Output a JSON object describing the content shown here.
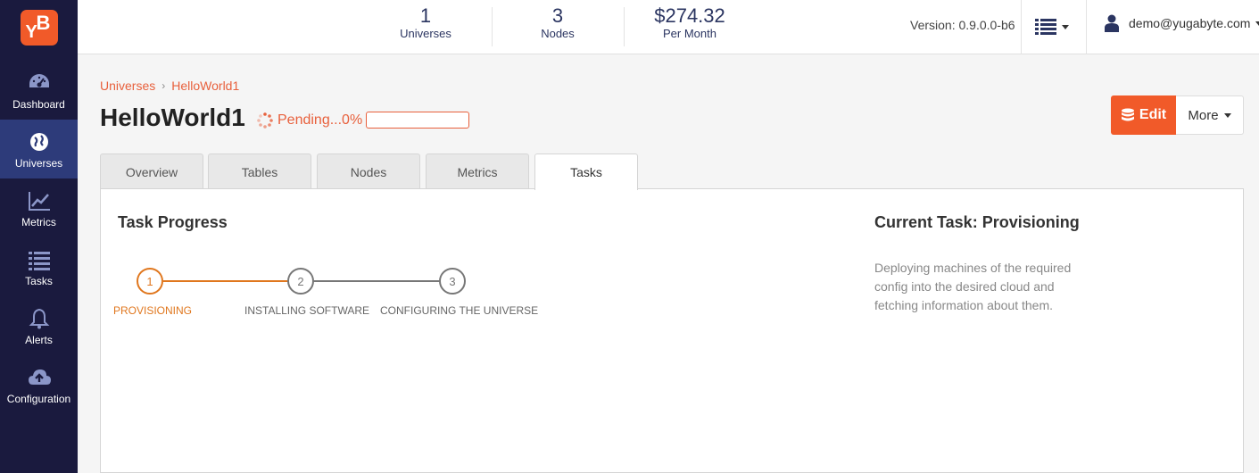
{
  "logo": {
    "l1": "Y",
    "l2": "B"
  },
  "sidebar": {
    "items": [
      {
        "label": "Dashboard",
        "icon": "dashboard-icon"
      },
      {
        "label": "Universes",
        "icon": "globe-icon",
        "active": true
      },
      {
        "label": "Metrics",
        "icon": "line-chart-icon"
      },
      {
        "label": "Tasks",
        "icon": "list-icon"
      },
      {
        "label": "Alerts",
        "icon": "bell-icon"
      },
      {
        "label": "Configuration",
        "icon": "cloud-upload-icon"
      }
    ]
  },
  "header": {
    "stats": [
      {
        "value": "1",
        "label": "Universes"
      },
      {
        "value": "3",
        "label": "Nodes"
      },
      {
        "value": "$274.32",
        "label": "Per Month"
      }
    ],
    "version": "Version: 0.9.0.0-b6",
    "user": "demo@yugabyte.com"
  },
  "breadcrumb": {
    "root": "Universes",
    "separator": "›",
    "current": "HelloWorld1"
  },
  "universe": {
    "name": "HelloWorld1",
    "status": "Pending...0%",
    "progress_percent": 0
  },
  "actions": {
    "edit": "Edit",
    "more": "More"
  },
  "tabs": [
    "Overview",
    "Tables",
    "Nodes",
    "Metrics",
    "Tasks"
  ],
  "active_tab": "Tasks",
  "task_progress": {
    "title": "Task Progress",
    "steps": [
      {
        "number": "1",
        "label": "PROVISIONING",
        "active": true
      },
      {
        "number": "2",
        "label": "INSTALLING SOFTWARE",
        "active": false
      },
      {
        "number": "3",
        "label": "CONFIGURING THE UNIVERSE",
        "active": false
      }
    ]
  },
  "current_task": {
    "title": "Current Task: Provisioning",
    "description": "Deploying machines of the required config into the desired cloud and fetching information about them."
  },
  "colors": {
    "sidebar": "#1a1a3e",
    "sidebar_active": "#2d3b7a",
    "accent": "#f15a29",
    "step_active": "#e0771e"
  }
}
